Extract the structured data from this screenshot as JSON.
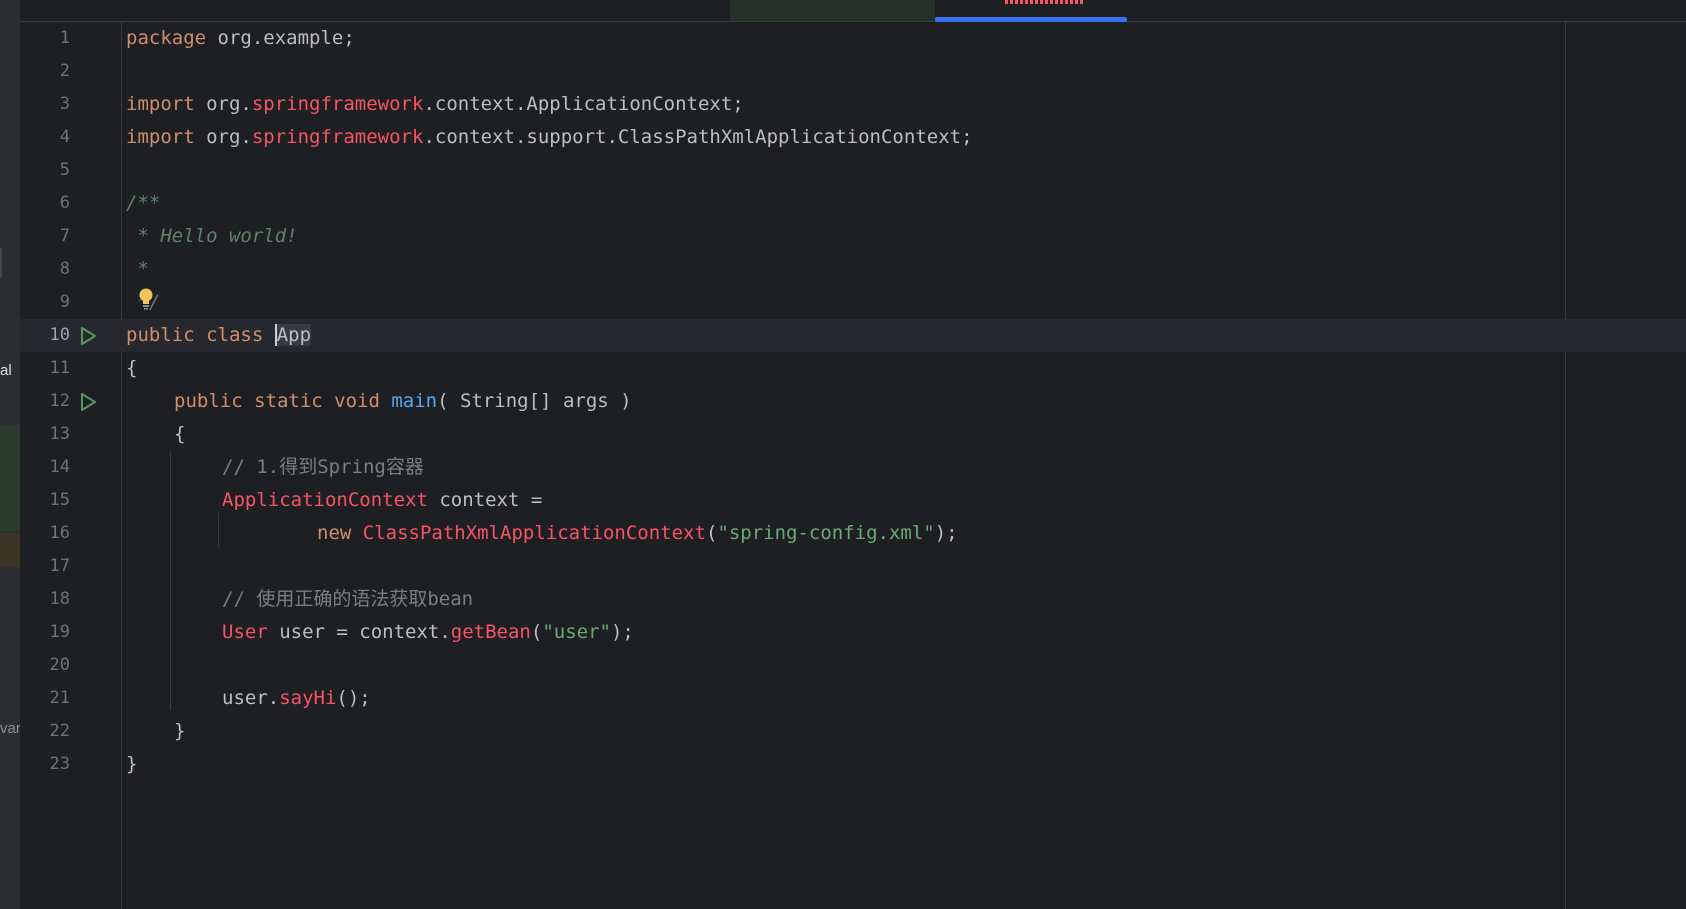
{
  "side_panel": {
    "label_top": "al",
    "label_bottom": "var"
  },
  "colors": {
    "background": "#1e1f22",
    "keyword": "#cf8e6d",
    "error_red": "#f75464",
    "method_blue": "#56a8f5",
    "string_green": "#6aab73",
    "comment_gray": "#7a7e85",
    "doc_green": "#5f826b",
    "tab_underline": "#3574f0"
  },
  "editor": {
    "current_line": 10,
    "lines": [
      {
        "n": "1"
      },
      {
        "n": "2"
      },
      {
        "n": "3"
      },
      {
        "n": "4"
      },
      {
        "n": "5"
      },
      {
        "n": "6"
      },
      {
        "n": "7"
      },
      {
        "n": "8"
      },
      {
        "n": "9"
      },
      {
        "n": "10"
      },
      {
        "n": "11"
      },
      {
        "n": "12"
      },
      {
        "n": "13"
      },
      {
        "n": "14"
      },
      {
        "n": "15"
      },
      {
        "n": "16"
      },
      {
        "n": "17"
      },
      {
        "n": "18"
      },
      {
        "n": "19"
      },
      {
        "n": "20"
      },
      {
        "n": "21"
      },
      {
        "n": "22"
      },
      {
        "n": "23"
      }
    ],
    "tokens": {
      "l1": {
        "kw": "package",
        "rest": " org.example;"
      },
      "l3": {
        "kw": "import",
        "a": " org.",
        "err": "springframework",
        "b": ".context.ApplicationContext;"
      },
      "l4": {
        "kw": "import",
        "a": " org.",
        "err": "springframework",
        "b": ".context.support.ClassPathXmlApplicationContext;"
      },
      "l6": {
        "doc": "/**"
      },
      "l7": {
        "doc": " * Hello world!"
      },
      "l8": {
        "doc": " *"
      },
      "l9": {
        "doc": " */"
      },
      "l10": {
        "kw": "public class ",
        "cls": "App"
      },
      "l11": {
        "text": "{"
      },
      "l12": {
        "kw": "public static void ",
        "fn": "main",
        "rest": "( String[] args )"
      },
      "l13": {
        "text": "{"
      },
      "l14": {
        "cm": "// 1.得到Spring容器"
      },
      "l15": {
        "err": "ApplicationContext",
        "rest": " context ="
      },
      "l16": {
        "kw": "new ",
        "err": "ClassPathXmlApplicationContext",
        "a": "(",
        "str": "\"spring-config.xml\"",
        "b": ");"
      },
      "l18": {
        "cm": "// 使用正确的语法获取bean"
      },
      "l19": {
        "err": "User",
        "a": " user = context.",
        "err2": "getBean",
        "b": "(",
        "str": "\"user\"",
        "c": ");"
      },
      "l21": {
        "a": "user.",
        "err": "sayHi",
        "b": "();"
      },
      "l22": {
        "text": "}"
      },
      "l23": {
        "text": "}"
      }
    }
  }
}
